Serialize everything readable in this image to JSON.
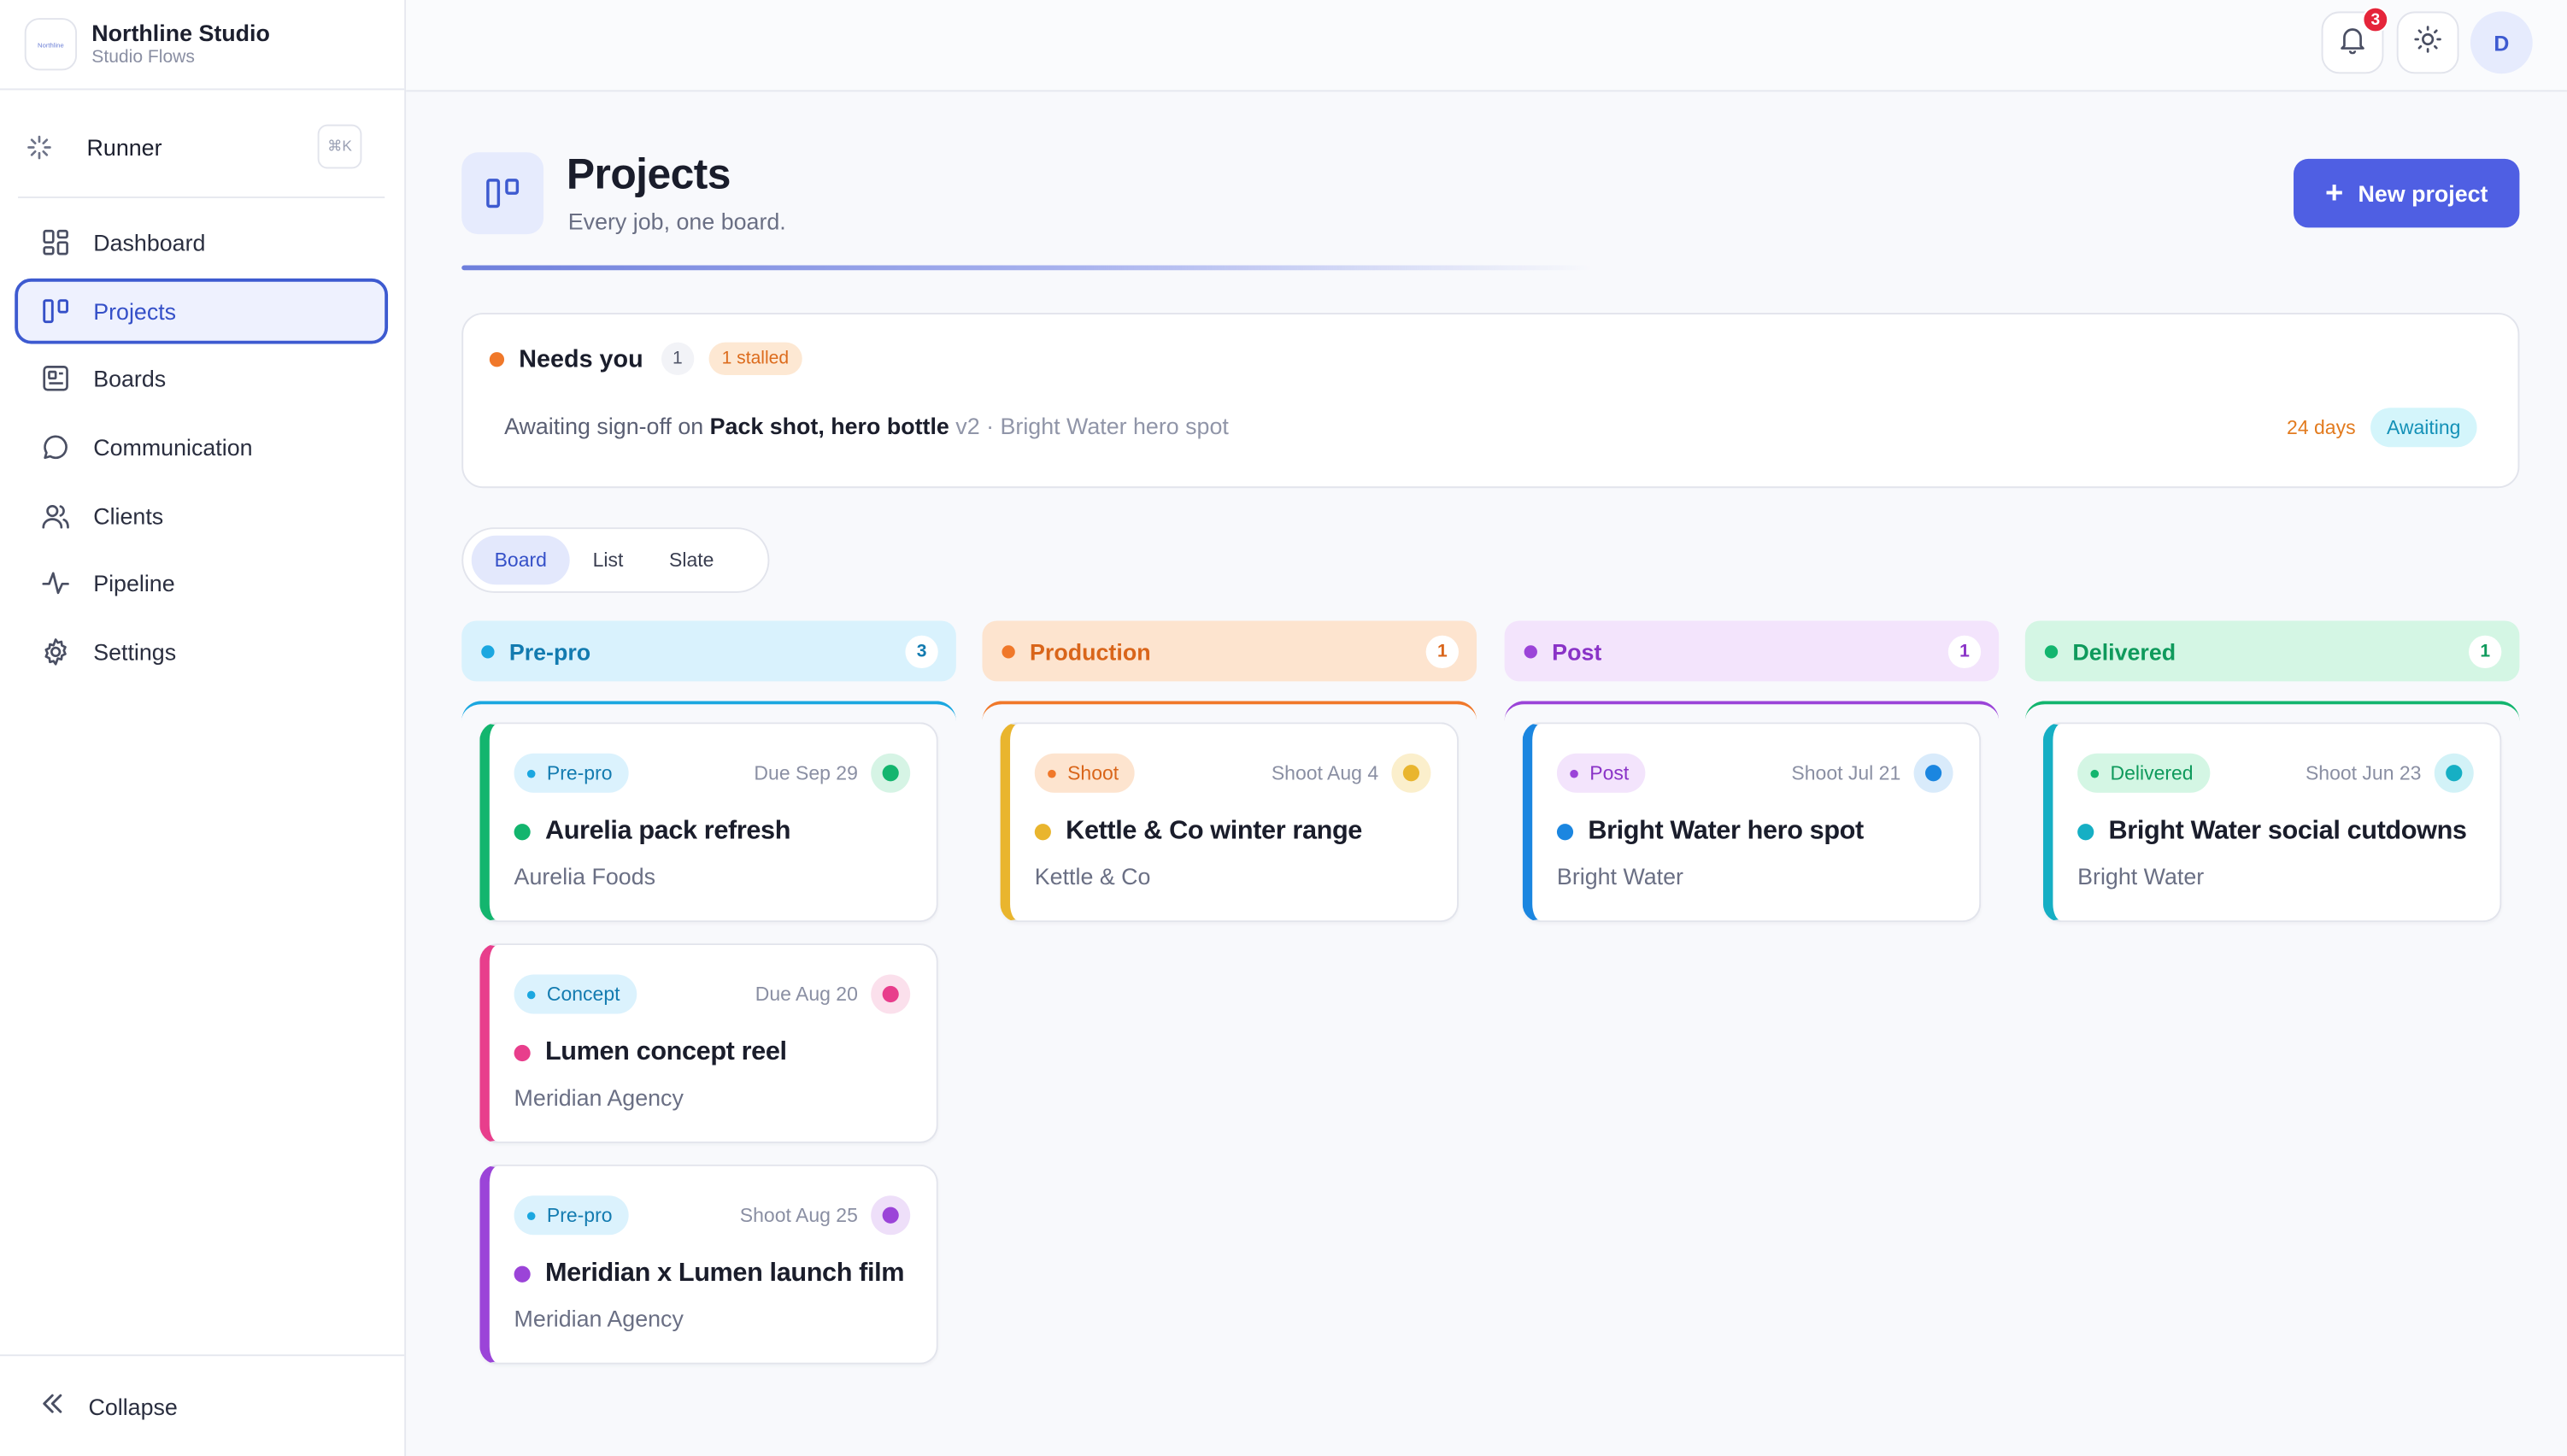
{
  "brand": {
    "name": "Northline Studio",
    "subtitle": "Studio Flows",
    "logo_text": "Northline"
  },
  "sidebar": {
    "runner": {
      "label": "Runner",
      "shortcut": "⌘K"
    },
    "items": [
      {
        "label": "Dashboard",
        "icon": "dashboard-icon"
      },
      {
        "label": "Projects",
        "icon": "projects-icon",
        "active": true
      },
      {
        "label": "Boards",
        "icon": "boards-icon"
      },
      {
        "label": "Communication",
        "icon": "chat-icon"
      },
      {
        "label": "Clients",
        "icon": "users-icon"
      },
      {
        "label": "Pipeline",
        "icon": "activity-icon"
      },
      {
        "label": "Settings",
        "icon": "gear-icon"
      }
    ],
    "collapse_label": "Collapse"
  },
  "topbar": {
    "notifications_count": "3",
    "avatar_initial": "D"
  },
  "page": {
    "title": "Projects",
    "subtitle": "Every job, one board.",
    "new_button": "New project"
  },
  "needs": {
    "title": "Needs you",
    "count": "1",
    "stalled": "1 stalled",
    "row": {
      "prefix": "Awaiting sign-off on",
      "item": "Pack shot, hero bottle",
      "version": "v2",
      "separator": "·",
      "project": "Bright Water hero spot",
      "days": "24 days",
      "status": "Awaiting"
    }
  },
  "views": {
    "tabs": [
      "Board",
      "List",
      "Slate"
    ],
    "active": "Board"
  },
  "colors": {
    "accent": "#4f5fe3",
    "prepro": "#1ba7e0",
    "production": "#f0782a",
    "post": "#9b44d8",
    "delivered": "#13b56e"
  },
  "columns": [
    {
      "name": "Pre-pro",
      "count": "3",
      "cards": [
        {
          "tag": "Pre-pro",
          "date": "Due Sep 29",
          "title": "Aurelia pack refresh",
          "client": "Aurelia Foods"
        },
        {
          "tag": "Concept",
          "date": "Due Aug 20",
          "title": "Lumen concept reel",
          "client": "Meridian Agency"
        },
        {
          "tag": "Pre-pro",
          "date": "Shoot Aug 25",
          "title": "Meridian x Lumen launch film",
          "client": "Meridian Agency"
        }
      ]
    },
    {
      "name": "Production",
      "count": "1",
      "cards": [
        {
          "tag": "Shoot",
          "date": "Shoot Aug 4",
          "title": "Kettle & Co winter range",
          "client": "Kettle & Co"
        }
      ]
    },
    {
      "name": "Post",
      "count": "1",
      "cards": [
        {
          "tag": "Post",
          "date": "Shoot Jul 21",
          "title": "Bright Water hero spot",
          "client": "Bright Water"
        }
      ]
    },
    {
      "name": "Delivered",
      "count": "1",
      "cards": [
        {
          "tag": "Delivered",
          "date": "Shoot Jun 23",
          "title": "Bright Water social cutdowns",
          "client": "Bright Water"
        }
      ]
    }
  ]
}
